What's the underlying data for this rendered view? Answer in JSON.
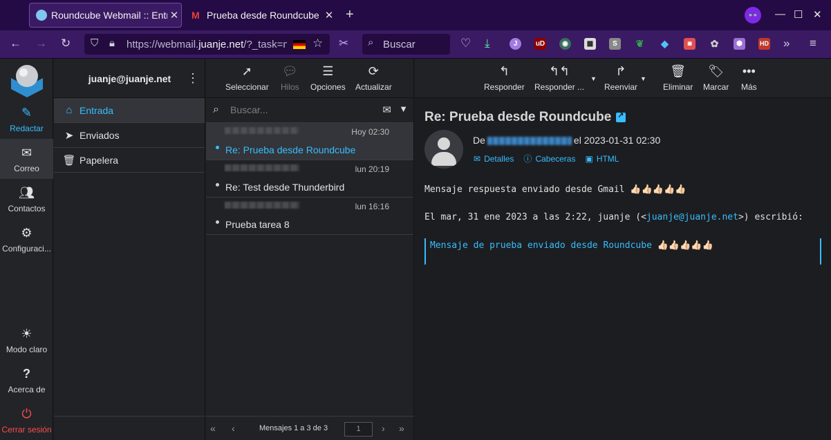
{
  "browser": {
    "tabs": [
      {
        "title": "Roundcube Webmail :: Entrada",
        "active": true
      },
      {
        "title": "Prueba desde Roundcube",
        "active": false
      }
    ],
    "url_prefix": "https://webmail.",
    "url_domain": "juanje.net",
    "url_suffix": "/?_task=mail",
    "search_placeholder": "Buscar"
  },
  "nav": {
    "compose": "Redactar",
    "mail": "Correo",
    "contacts": "Contactos",
    "settings": "Configuraci...",
    "light_mode": "Modo claro",
    "about": "Acerca de",
    "logout": "Cerrar sesión"
  },
  "account": {
    "user": "juanje@juanje.net"
  },
  "folders": [
    {
      "label": "Entrada",
      "icon": "inbox-icon",
      "selected": true
    },
    {
      "label": "Enviados",
      "icon": "paper-plane-icon",
      "selected": false
    },
    {
      "label": "Papelera",
      "icon": "trash-icon",
      "selected": false
    }
  ],
  "list_toolbar": {
    "select": "Seleccionar",
    "threads": "Hilos",
    "options": "Opciones",
    "refresh": "Actualizar"
  },
  "list_search": {
    "placeholder": "Buscar..."
  },
  "messages": [
    {
      "date": "Hoy 02:30",
      "subject": "Re: Prueba desde Roundcube",
      "selected": true
    },
    {
      "date": "lun 20:19",
      "subject": "Re: Test desde Thunderbird",
      "selected": false
    },
    {
      "date": "lun 16:16",
      "subject": "Prueba tarea 8",
      "selected": false
    }
  ],
  "list_footer": {
    "count": "Mensajes 1 a 3 de 3",
    "page": "1"
  },
  "reader_toolbar": {
    "reply": "Responder",
    "reply_all": "Responder ...",
    "forward": "Reenviar",
    "delete": "Eliminar",
    "mark": "Marcar",
    "more": "Más"
  },
  "message": {
    "subject": "Re: Prueba desde Roundcube",
    "from_prefix": "De",
    "date_text": "el 2023-01-31 02:30",
    "details": "Detalles",
    "headers": "Cabeceras",
    "html": "HTML",
    "body_line1": "Mensaje respuesta enviado desde Gmail 👍🏻👍🏻👍🏻👍🏻👍🏻",
    "body_line2_pre": "El mar, 31 ene 2023 a las 2:22, juanje (<",
    "body_line2_link": "juanje@juanje.net",
    "body_line2_post": ">) escribió:",
    "quote": "Mensaje de prueba enviado desde Roundcube 👍🏻👍🏻👍🏻👍🏻👍🏻"
  },
  "colors": {
    "accent": "#37beff",
    "logout": "#ff4d4d",
    "browser_bg": "#250b45"
  }
}
